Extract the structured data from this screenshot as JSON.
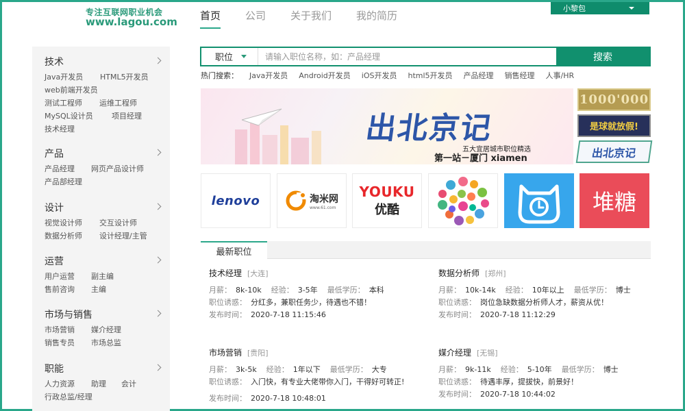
{
  "header": {
    "tagline": "专注互联网职业机会",
    "site": "www.lagou.com",
    "nav": [
      "首页",
      "公司",
      "关于我们",
      "我的简历"
    ],
    "user": "小黎包"
  },
  "sidebar": [
    {
      "title": "技术",
      "links": [
        "Java开发员",
        "HTML5开发员",
        "web前端开发员",
        "测试工程师",
        "运维工程师",
        "MySQL设计员",
        "项目经理",
        "技术经理"
      ]
    },
    {
      "title": "产品",
      "links": [
        "产品经理",
        "网页产品设计师",
        "产品部经理"
      ]
    },
    {
      "title": "设计",
      "links": [
        "视觉设计师",
        "交互设计师",
        "数据分析师",
        "设计经理/主管"
      ]
    },
    {
      "title": "运营",
      "links": [
        "用户运营",
        "副主编",
        "售前咨询",
        "主编"
      ]
    },
    {
      "title": "市场与销售",
      "links": [
        "市场营销",
        "媒介经理",
        "销售专员",
        "市场总监"
      ]
    },
    {
      "title": "职能",
      "links": [
        "人力资源",
        "助理",
        "会计",
        "行政总监/经理"
      ]
    }
  ],
  "search": {
    "select": "职位",
    "placeholder": "请输入职位名称，如：产品经理",
    "button": "搜索"
  },
  "hot": {
    "label": "热门搜索：",
    "items": [
      "Java开发员",
      "Android开发员",
      "iOS开发员",
      "html5开发员",
      "产品经理",
      "销售经理",
      "人事/HR"
    ]
  },
  "banner": {
    "title": "出北京记",
    "sub1": "五大宜居城市职位精选",
    "sub2": "第一站－厦门 xiamen",
    "thumbs": [
      "1000'000",
      "是球就放假!",
      "出北京记"
    ]
  },
  "logos": {
    "lenovo": "lenovo",
    "taomi_cn": "淘米网",
    "taomi_url": "www.61.com",
    "youku_en": "YOUKU",
    "youku_cn": "优酷",
    "duitang": "堆糖"
  },
  "tabs": [
    "最新职位"
  ],
  "jobs_labels": {
    "salary": "月薪：",
    "exp": "经验：",
    "edu": "最低学历：",
    "perk": "职位诱惑：",
    "time": "发布时间："
  },
  "jobs": [
    {
      "title": "技术经理",
      "city": "[大连]",
      "salary": "8k-10k",
      "exp": "3-5年",
      "edu": "本科",
      "perk": "分红多，兼职任务少，待遇也不错！",
      "time": "2020-7-18 11:15:46"
    },
    {
      "title": "数据分析师",
      "city": "[郑州]",
      "salary": "10k-14k",
      "exp": "10年以上",
      "edu": "博士",
      "perk": "岗位急缺数据分析师人才，薪资从优！",
      "time": "2020-7-18 11:12:29"
    },
    {
      "title": "市场营销",
      "city": "[贵阳]",
      "salary": "3k-5k",
      "exp": "1年以下",
      "edu": "大专",
      "perk": "入门快，有专业大佬带你入门，干得好可转正!",
      "time": "2020-7-18 10:48:01"
    },
    {
      "title": "媒介经理",
      "city": "[无锡]",
      "salary": "9k-11k",
      "exp": "5-10年",
      "edu": "博士",
      "perk": "待遇丰厚，提拔快，前景好！",
      "time": "2020-7-18 10:44:02"
    }
  ]
}
